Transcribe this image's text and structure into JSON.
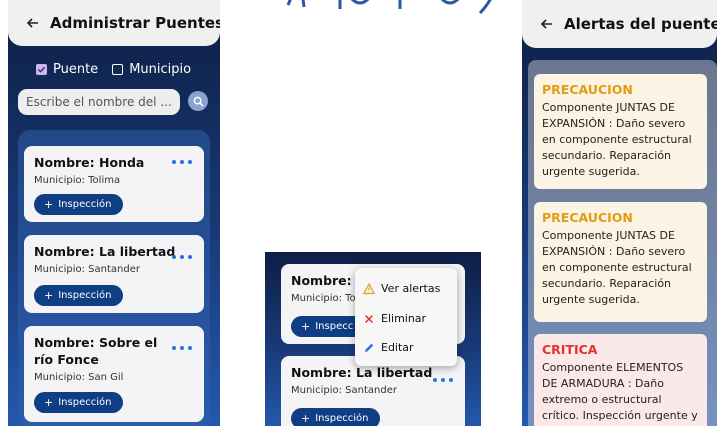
{
  "colors": {
    "precaucion": "#e39a14",
    "critica": "#e0342c",
    "accent": "#0f3e85",
    "dots": "#2d6fe0"
  },
  "screen1": {
    "title": "Administrar Puentes",
    "filters": [
      {
        "label": "Puente",
        "checked": true
      },
      {
        "label": "Municipio",
        "checked": false
      }
    ],
    "search_placeholder": "Escribe el nombre del ...",
    "bridges": [
      {
        "name": "Nombre: Honda",
        "municipio": "Municipio: Tolima",
        "button": "Inspección"
      },
      {
        "name": "Nombre: La libertad",
        "municipio": "Municipio: Santander",
        "button": "Inspección"
      },
      {
        "name": "Nombre: Sobre el río Fonce",
        "municipio": "Municipio: San Gil",
        "button": "Inspección"
      }
    ]
  },
  "screen2": {
    "card1": {
      "name": "Nombre: H",
      "municipio": "Municipio: To",
      "button": "Inspecc"
    },
    "card2": {
      "name": "Nombre: La libertad",
      "municipio": "Municipio: Santander",
      "button": "Inspección"
    },
    "menu": [
      {
        "label": "Ver alertas",
        "icon": "warning-icon"
      },
      {
        "label": "Eliminar",
        "icon": "close-icon"
      },
      {
        "label": "Editar",
        "icon": "pencil-icon"
      }
    ]
  },
  "screen3": {
    "title": "Alertas del puente",
    "alerts": [
      {
        "level": "PRECAUCION",
        "text": "Componente JUNTAS DE EXPANSIÓN : Daño severo en componente estructural secundario. Reparación urgente sugerida."
      },
      {
        "level": "PRECAUCION",
        "text": "Componente JUNTAS DE EXPANSIÓN : Daño severo en componente estructural secundario. Reparación urgente sugerida."
      },
      {
        "level": "CRITICA",
        "text": "Componente ELEMENTOS DE ARMADURA : Daño extremo o estructural crítico. Inspección urgente y posible"
      }
    ]
  }
}
